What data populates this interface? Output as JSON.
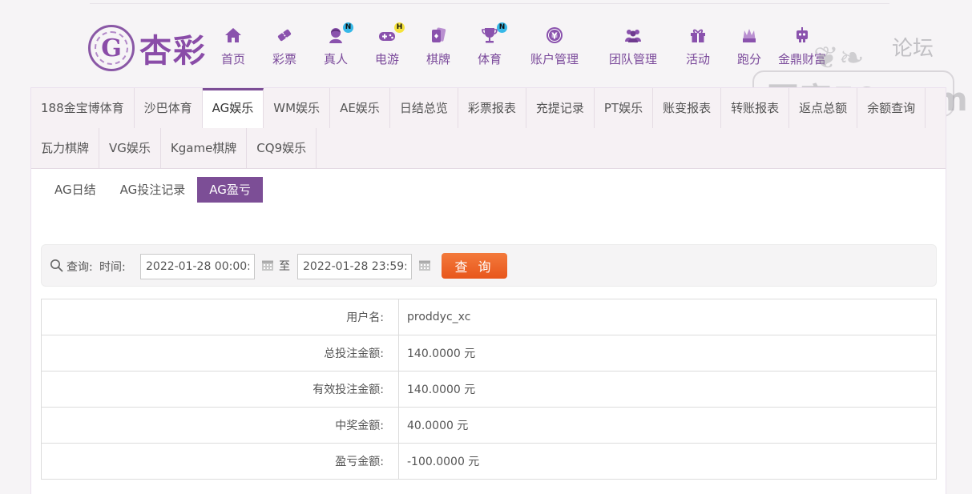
{
  "logo": {
    "badge_letter": "G",
    "text": "杏彩"
  },
  "nav": [
    {
      "label": "首页",
      "icon": "home-icon",
      "badge": ""
    },
    {
      "label": "彩票",
      "icon": "lottery-ticket-icon",
      "badge": ""
    },
    {
      "label": "真人",
      "icon": "live-dealer-icon",
      "badge": "N"
    },
    {
      "label": "电游",
      "icon": "gamepad-icon",
      "badge": "H"
    },
    {
      "label": "棋牌",
      "icon": "playing-cards-icon",
      "badge": ""
    },
    {
      "label": "体育",
      "icon": "trophy-icon",
      "badge": "N"
    },
    {
      "label": "账户管理",
      "icon": "yuan-coin-icon",
      "badge": ""
    },
    {
      "label": "团队管理",
      "icon": "team-icon",
      "badge": ""
    },
    {
      "label": "活动",
      "icon": "gift-icon",
      "badge": ""
    },
    {
      "label": "跑分",
      "icon": "speed-icon",
      "badge": ""
    },
    {
      "label": "金鼎财富",
      "icon": "robot-icon",
      "badge": ""
    }
  ],
  "watermark": {
    "main": "回家50.com",
    "forum": "论坛"
  },
  "tabs_row1": [
    "188金宝博体育",
    "沙巴体育",
    "AG娱乐",
    "WM娱乐",
    "AE娱乐",
    "日结总览",
    "彩票报表",
    "充提记录",
    "PT娱乐",
    "账变报表",
    "转账报表",
    "返点总额",
    "余额查询"
  ],
  "tabs_row2": [
    "瓦力棋牌",
    "VG娱乐",
    "Kgame棋牌",
    "CQ9娱乐"
  ],
  "active_tab": "AG娱乐",
  "subtabs": [
    "AG日结",
    "AG投注记录",
    "AG盈亏"
  ],
  "active_subtab": "AG盈亏",
  "query": {
    "label": "查询:",
    "time_label": "时间:",
    "start": "2022-01-28 00:00:00",
    "to": "至",
    "end": "2022-01-28 23:59:59",
    "button": "查 询"
  },
  "result": [
    {
      "key": "用户名:",
      "value": "proddyc_xc"
    },
    {
      "key": "总投注金额:",
      "value": "140.0000 元"
    },
    {
      "key": "有效投注金额:",
      "value": "140.0000 元"
    },
    {
      "key": "中奖金额:",
      "value": "40.0000 元"
    },
    {
      "key": "盈亏金额:",
      "value": "-100.0000 元"
    }
  ],
  "colors": {
    "brand": "#7c4e96",
    "query_button": "#e8561c",
    "nav_text": "#7b4a9b"
  }
}
